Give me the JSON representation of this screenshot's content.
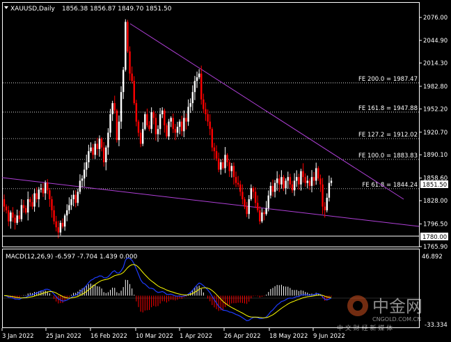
{
  "header": {
    "symbol_label": "XAUUSD,Daily",
    "ohlc": "1856.38 1856.87 1849.70 1851.50"
  },
  "price_axis": {
    "ticks": [
      "2076.00",
      "2044.90",
      "2014.30",
      "1982.80",
      "1952.20",
      "1920.70",
      "1890.10",
      "1858.60",
      "1828.00",
      "1796.50",
      "1765.90"
    ],
    "current_price": "1851.50",
    "level_1780": "1780.00"
  },
  "fib_levels": [
    {
      "label": "FE 200.0 = 1987.47",
      "value": 1987.47
    },
    {
      "label": "FE 161.8 = 1947.88",
      "value": 1947.88
    },
    {
      "label": "FE 127.2 = 1912.02",
      "value": 1912.02
    },
    {
      "label": "FE 100.0 = 1883.83",
      "value": 1883.83
    },
    {
      "label": "FE 61.8 = 1844.24",
      "value": 1844.24
    }
  ],
  "macd": {
    "label": "MACD(12,26,9) -6.597 -7.704 1.439 0.000",
    "top_tick": "46.892",
    "bottom_tick": "-33.334"
  },
  "date_axis": [
    "3 Jan 2022",
    "25 Jan 2022",
    "16 Feb 2022",
    "10 Mar 2022",
    "1 Apr 2022",
    "26 Apr 2022",
    "18 May 2022",
    "9 Jun 2022"
  ],
  "watermark": {
    "brand": "中金网",
    "site": "CNGOLD.COM.CN",
    "tagline": "中 文 财 经 新 媒 体"
  },
  "colors": {
    "bull": "#ffffff",
    "bear": "#ff0000",
    "trendline": "#b040d8",
    "macd_signal": "#ffff00",
    "macd_line": "#1e3cff",
    "grid": "#ffffff"
  },
  "chart_data": {
    "type": "candlestick",
    "start_price": 1830,
    "price_range": [
      1765.9,
      2076
    ],
    "ohlc_closes": [
      1820,
      1815,
      1800,
      1812,
      1805,
      1798,
      1808,
      1803,
      1822,
      1818,
      1812,
      1830,
      1826,
      1820,
      1838,
      1830,
      1843,
      1845,
      1838,
      1852,
      1842,
      1830,
      1815,
      1800,
      1792,
      1785,
      1798,
      1793,
      1808,
      1815,
      1822,
      1830,
      1836,
      1825,
      1840,
      1855,
      1858,
      1870,
      1880,
      1895,
      1900,
      1890,
      1905,
      1898,
      1912,
      1900,
      1880,
      1900,
      1920,
      1945,
      1960,
      1950,
      1910,
      1935,
      1975,
      2005,
      2070,
      2030,
      2000,
      1990,
      1960,
      1935,
      1920,
      1905,
      1925,
      1945,
      1930,
      1925,
      1948,
      1940,
      1918,
      1925,
      1945,
      1950,
      1930,
      1915,
      1935,
      1940,
      1925,
      1920,
      1928,
      1935,
      1922,
      1940,
      1935,
      1955,
      1960,
      1975,
      1990,
      1995,
      2000,
      1965,
      1952,
      1945,
      1935,
      1925,
      1900,
      1895,
      1885,
      1870,
      1880,
      1872,
      1890,
      1880,
      1868,
      1875,
      1860,
      1852,
      1850,
      1840,
      1830,
      1820,
      1810,
      1830,
      1845,
      1840,
      1825,
      1815,
      1800,
      1812,
      1810,
      1818,
      1835,
      1848,
      1840,
      1852,
      1858,
      1850,
      1860,
      1845,
      1855,
      1860,
      1850,
      1842,
      1855,
      1860,
      1850,
      1868,
      1860,
      1852,
      1855,
      1848,
      1860,
      1855,
      1872,
      1858,
      1850,
      1820,
      1815,
      1832,
      1852,
      1855
    ]
  }
}
